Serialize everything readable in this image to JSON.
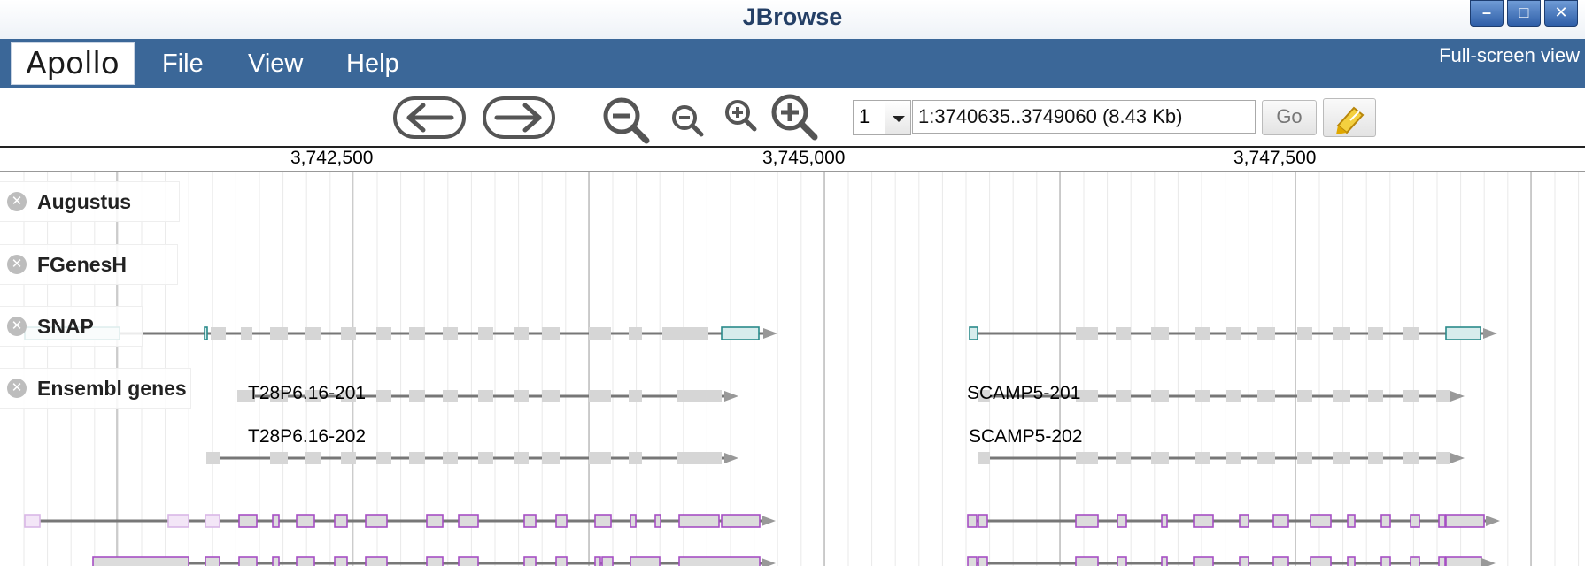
{
  "window": {
    "title": "JBrowse",
    "controls": {
      "minimize": "–",
      "maximize": "□",
      "close": "✕"
    }
  },
  "menubar": {
    "logo": "Apollo",
    "items": [
      "File",
      "View",
      "Help"
    ],
    "fullscreen_label": "Full-screen view"
  },
  "toolbar": {
    "pan_left": "arrow-left-icon",
    "pan_right": "arrow-right-icon",
    "zoom_buttons": [
      "zoom-out-large-icon",
      "zoom-out-small-icon",
      "zoom-in-small-icon",
      "zoom-in-large-icon"
    ],
    "refseq_value": "1",
    "location_value": "1:3740635..3749060 (8.43 Kb)",
    "go_label": "Go",
    "highlight_icon": "highlighter-icon"
  },
  "ruler": {
    "labels": [
      "3,742,500",
      "3,745,000",
      "3,747,500"
    ]
  },
  "tracks": [
    {
      "name": "Augustus",
      "close_icon": "close-circle-icon"
    },
    {
      "name": "FGenesH",
      "close_icon": "close-circle-icon"
    },
    {
      "name": "SNAP",
      "close_icon": "close-circle-icon"
    },
    {
      "name": "Ensembl genes",
      "close_icon": "close-circle-icon"
    }
  ],
  "features": {
    "ensembl": [
      "T28P6.16-201",
      "T28P6.16-202",
      "SCAMP5-201",
      "SCAMP5-202"
    ]
  },
  "colors": {
    "menubar": "#3b6798",
    "title_text": "#243f66",
    "augustus_utr": "#2a8a8a",
    "ensembl_exon": "#a64fc4",
    "feature_grey": "#d6d6d6",
    "intron_line": "#777777"
  }
}
